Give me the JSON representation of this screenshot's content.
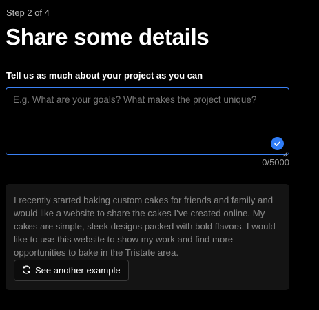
{
  "step_indicator": "Step 2 of 4",
  "title": "Share some details",
  "details_field": {
    "label": "Tell us as much about your project as you can",
    "placeholder": "E.g. What are your goals? What makes the project unique?",
    "value": "",
    "counter": "0/5000",
    "status_icon": "checkmark-icon"
  },
  "example": {
    "text": "I recently started baking custom cakes for friends and family and would like a website to share the cakes I’ve created online. My cakes are simple, sleek designs packed with bold flavors. I would like to use this website to show my work and find more opportunities to bake in the Tristate area.",
    "button_label": "See another example",
    "button_icon": "refresh-icon"
  },
  "colors": {
    "background": "#000000",
    "accent": "#2f7cf6",
    "card": "#141414"
  }
}
